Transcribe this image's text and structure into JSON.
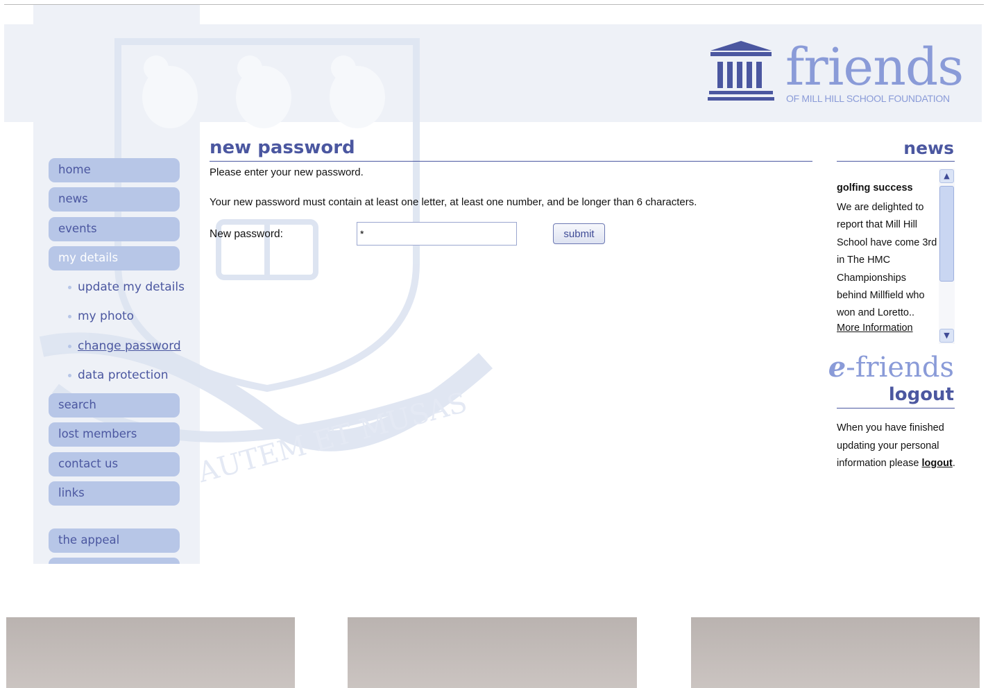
{
  "brand": {
    "logo_word": "friends",
    "logo_subtitle": "OF MILL HILL SCHOOL FOUNDATION",
    "motto": "AUTEM ET MUSAS",
    "colors": {
      "primary": "#4b57a0",
      "logo": "#8a9bd8",
      "nav_bg": "#b7c6e7",
      "panel_bg": "#eef1f7"
    }
  },
  "nav": {
    "items": [
      {
        "label": "home"
      },
      {
        "label": "news"
      },
      {
        "label": "events"
      },
      {
        "label": "my details"
      },
      {
        "label": "search"
      },
      {
        "label": "lost members"
      },
      {
        "label": "contact us"
      },
      {
        "label": "links"
      },
      {
        "label": "the appeal"
      }
    ],
    "sub_items": [
      {
        "label": "update my details"
      },
      {
        "label": "my photo"
      },
      {
        "label": "change password"
      },
      {
        "label": "data protection"
      }
    ]
  },
  "main": {
    "title": "new password",
    "intro": "Please enter your new password.",
    "rules": "Your new password must contain at least one letter, at least one number, and be longer than 6 characters.",
    "field_label": "New password:",
    "field_value": "*",
    "submit_label": "submit"
  },
  "news": {
    "title": "news",
    "headline": "golfing success",
    "body": "We are delighted to report that Mill Hill School have come 3rd in The HMC Championships behind Millfield who won and Loretto..",
    "more": "More Information",
    "scroll_up_icon": "chevron-up-icon",
    "scroll_down_icon": "chevron-down-icon"
  },
  "efriends": {
    "e": "e",
    "rest": "-friends",
    "logout_title": "logout",
    "text_before": "When you have finished updating your personal information please ",
    "link": "logout",
    "text_after": "."
  }
}
